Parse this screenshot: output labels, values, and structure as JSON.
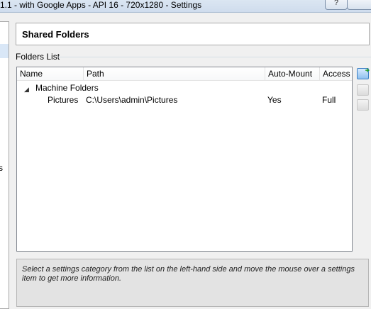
{
  "window": {
    "title": "1.1 - with Google Apps - API 16 - 720x1280 - Settings",
    "help_glyph": "?"
  },
  "sidebar": {
    "partial_label": "rs"
  },
  "page": {
    "header": "Shared Folders",
    "group_label": "Folders List"
  },
  "folders_list": {
    "columns": [
      "Name",
      "Path",
      "Auto-Mount",
      "Access"
    ],
    "group": "Machine Folders",
    "rows": [
      {
        "name": "Pictures",
        "path": "C:\\Users\\admin\\Pictures",
        "auto_mount": "Yes",
        "access": "Full"
      }
    ]
  },
  "toolbar": {
    "icons": [
      "add-shared-folder-icon",
      "edit-shared-folder-icon",
      "remove-shared-folder-icon"
    ]
  },
  "info": {
    "text": "Select a settings category from the list on the left-hand side and move the mouse over a settings item to get more information."
  }
}
